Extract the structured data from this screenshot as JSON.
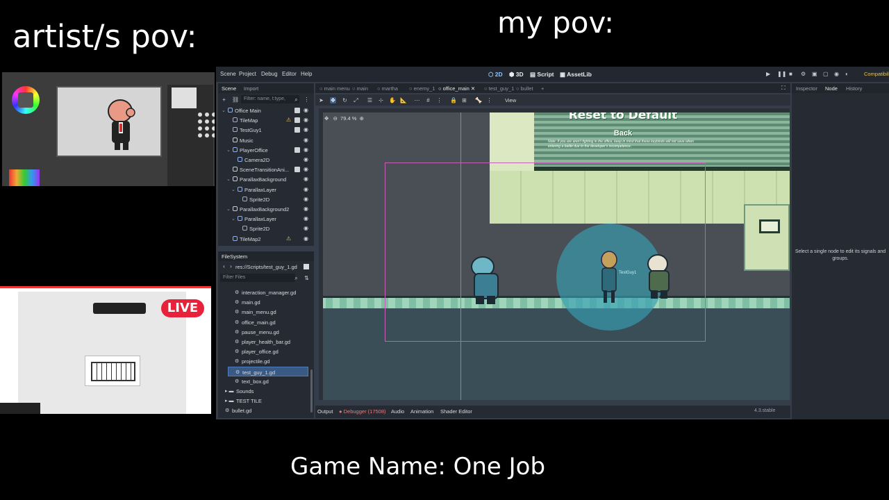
{
  "captions": {
    "artist": "artist/s pov:",
    "mine": "my pov:",
    "game": "Game Name: One Job"
  },
  "live_badge": "LIVE",
  "menubar": {
    "items": [
      "Scene",
      "Project",
      "Debug",
      "Editor",
      "Help"
    ],
    "modes": [
      "2D",
      "3D",
      "Script",
      "AssetLib"
    ],
    "active_mode": "2D",
    "renderer": "Compatibility"
  },
  "scene_dock": {
    "tabs": [
      "Scene",
      "Import"
    ],
    "filter_placeholder": "Filter: name, t:type,",
    "nodes": [
      {
        "label": "Office Main",
        "depth": 0,
        "icon_color": "#8fb0e8",
        "script": true,
        "warn": false
      },
      {
        "label": "TileMap",
        "depth": 1,
        "icon_color": "#8fb0e8",
        "script": true,
        "warn": true
      },
      {
        "label": "TestGuy1",
        "depth": 1,
        "icon_color": "#8fb0e8",
        "script": true,
        "warn": false
      },
      {
        "label": "Music",
        "depth": 1,
        "icon_color": "#c9cdd3",
        "script": false,
        "warn": false
      },
      {
        "label": "PlayerOffice",
        "depth": 1,
        "icon_color": "#8fb0e8",
        "script": true,
        "warn": false
      },
      {
        "label": "Camera2D",
        "depth": 2,
        "icon_color": "#8fb0e8",
        "script": false,
        "warn": false
      },
      {
        "label": "SceneTransitionAni...",
        "depth": 1,
        "icon_color": "#c9cdd3",
        "script": true,
        "warn": false
      },
      {
        "label": "ParallaxBackground",
        "depth": 1,
        "icon_color": "#c9cdd3",
        "script": false,
        "warn": false
      },
      {
        "label": "ParallaxLayer",
        "depth": 2,
        "icon_color": "#8fb0e8",
        "script": false,
        "warn": false
      },
      {
        "label": "Sprite2D",
        "depth": 3,
        "icon_color": "#8fb0e8",
        "script": false,
        "warn": false
      },
      {
        "label": "ParallaxBackground2",
        "depth": 1,
        "icon_color": "#c9cdd3",
        "script": false,
        "warn": false
      },
      {
        "label": "ParallaxLayer",
        "depth": 2,
        "icon_color": "#8fb0e8",
        "script": false,
        "warn": false
      },
      {
        "label": "Sprite2D",
        "depth": 3,
        "icon_color": "#8fb0e8",
        "script": false,
        "warn": false
      },
      {
        "label": "TileMap2",
        "depth": 1,
        "icon_color": "#8fb0e8",
        "script": false,
        "warn": true
      }
    ]
  },
  "filesystem": {
    "tab": "FileSystem",
    "path": "res://Scripts/test_guy_1.gd",
    "filter_placeholder": "Filter Files",
    "files": [
      {
        "label": "interaction_manager.gd",
        "type": "file"
      },
      {
        "label": "main.gd",
        "type": "file"
      },
      {
        "label": "main_menu.gd",
        "type": "file"
      },
      {
        "label": "office_main.gd",
        "type": "file"
      },
      {
        "label": "pause_menu.gd",
        "type": "file"
      },
      {
        "label": "player_health_bar.gd",
        "type": "file"
      },
      {
        "label": "player_office.gd",
        "type": "file"
      },
      {
        "label": "projectile.gd",
        "type": "file"
      },
      {
        "label": "test_guy_1.gd",
        "type": "file",
        "selected": true
      },
      {
        "label": "text_box.gd",
        "type": "file"
      },
      {
        "label": "Sounds",
        "type": "folder"
      },
      {
        "label": "TEST TILE",
        "type": "folder"
      },
      {
        "label": "bullet.gd",
        "type": "file"
      }
    ]
  },
  "scene_tabs": [
    "main menu",
    "main",
    "martha",
    "enemy_1",
    "office_main",
    "test_guy_1",
    "bullet"
  ],
  "active_scene_tab": "office_main",
  "toolbar": {
    "view_label": "View"
  },
  "viewport": {
    "zoom": "79.4 %",
    "reset_title": "Reset to Default",
    "back_label": "Back",
    "note": "Note: If you are aren't fighting in the office, keep in mind that these keybinds will not save when entering a battle due to the developer's incompetence.",
    "node_label": "TestGuy1"
  },
  "right_dock": {
    "tabs": [
      "Inspector",
      "Node",
      "History"
    ],
    "active_tab": "Node",
    "message": "Select a single node to edit its signals and groups."
  },
  "bottom_panel": {
    "tabs": [
      "Output",
      "Debugger (17508)",
      "Audio",
      "Animation",
      "Shader Editor"
    ],
    "version": "4.3.stable"
  },
  "colors": {
    "accent": "#8fc6ff",
    "warn": "#e9c54a",
    "live": "#e8223a"
  }
}
